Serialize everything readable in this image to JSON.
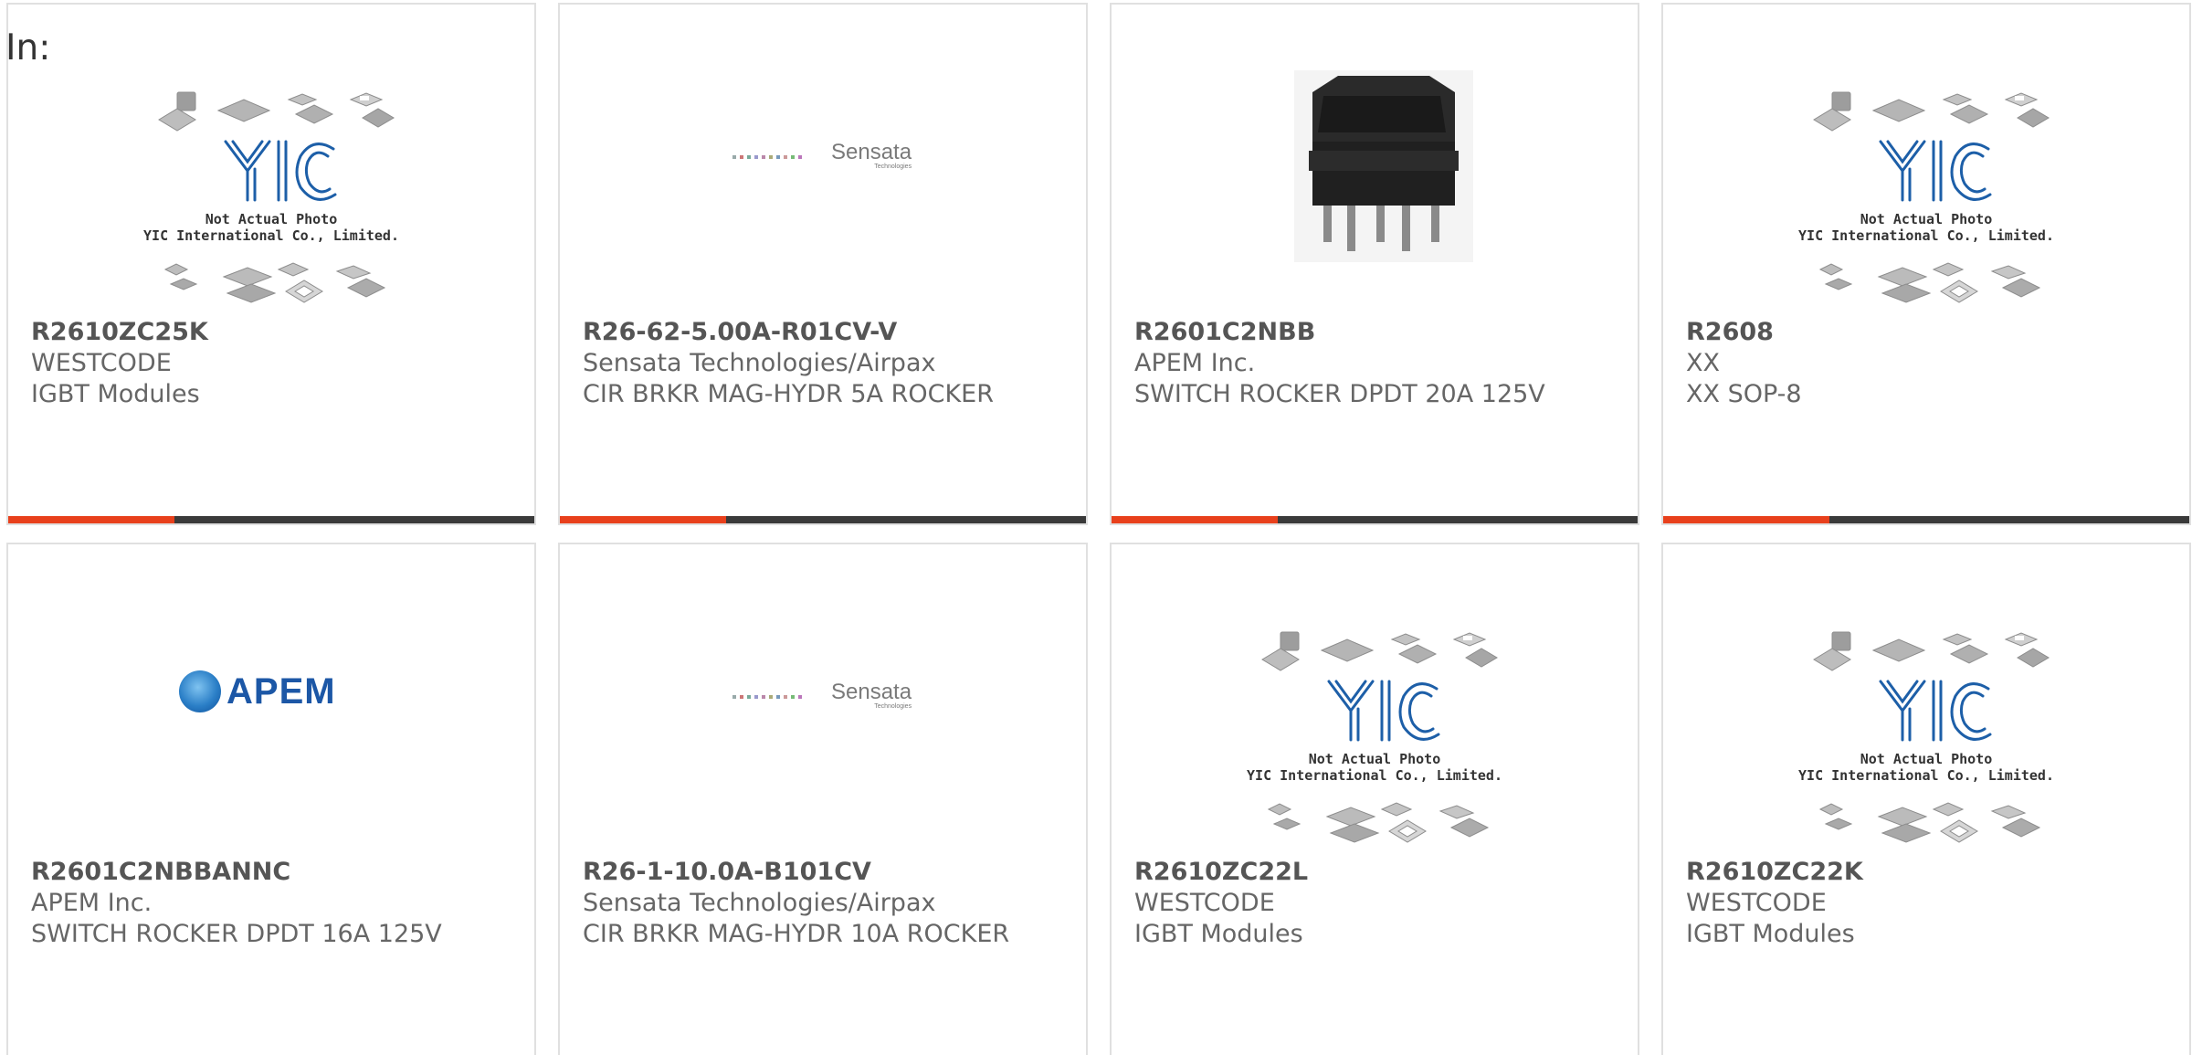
{
  "header": {
    "label": "In:"
  },
  "placeholder": {
    "line1": "Not Actual Photo",
    "line2": "YIC International Co., Limited."
  },
  "logos": {
    "sensata_name": "Sensata",
    "sensata_sub": "Technologies",
    "apem": "APEM"
  },
  "colors": {
    "accent": "#e8401c",
    "bar": "#3a3a3a",
    "yic_blue": "#1d5fa8"
  },
  "products": [
    {
      "part_number": "R2610ZC25K",
      "manufacturer": "WESTCODE",
      "description": "IGBT Modules",
      "image": "yic-placeholder"
    },
    {
      "part_number": "R26-62-5.00A-R01CV-V",
      "manufacturer": "Sensata Technologies/Airpax",
      "description": "CIR BRKR MAG-HYDR 5A ROCKER",
      "image": "sensata-logo"
    },
    {
      "part_number": "R2601C2NBB",
      "manufacturer": "APEM Inc.",
      "description": "SWITCH ROCKER DPDT 20A 125V",
      "image": "rocker-switch-photo"
    },
    {
      "part_number": "R2608",
      "manufacturer": "XX",
      "description": "XX SOP-8",
      "image": "yic-placeholder"
    },
    {
      "part_number": "R2601C2NBBANNC",
      "manufacturer": "APEM Inc.",
      "description": "SWITCH ROCKER DPDT 16A 125V",
      "image": "apem-logo"
    },
    {
      "part_number": "R26-1-10.0A-B101CV",
      "manufacturer": "Sensata Technologies/Airpax",
      "description": "CIR BRKR MAG-HYDR 10A ROCKER",
      "image": "sensata-logo"
    },
    {
      "part_number": "R2610ZC22L",
      "manufacturer": "WESTCODE",
      "description": "IGBT Modules",
      "image": "yic-placeholder"
    },
    {
      "part_number": "R2610ZC22K",
      "manufacturer": "WESTCODE",
      "description": "IGBT Modules",
      "image": "yic-placeholder"
    }
  ]
}
